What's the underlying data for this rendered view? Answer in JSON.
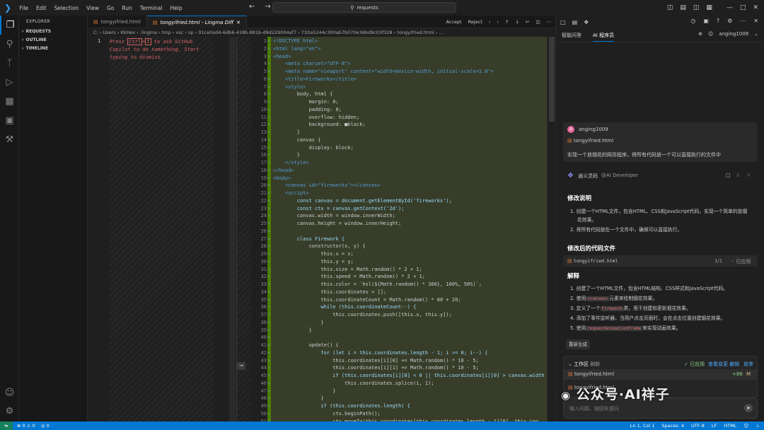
{
  "titlebar": {
    "menus": [
      "File",
      "Edit",
      "Selection",
      "View",
      "Go",
      "Run",
      "Terminal",
      "Help"
    ],
    "search": "requests"
  },
  "activity": [
    "files-icon",
    "search-icon",
    "source-control-icon",
    "run-debug-icon",
    "extensions-icon",
    "remote-icon",
    "testing-icon"
  ],
  "explorer": {
    "header": "EXPLORER",
    "sections": [
      "REQUESTS",
      "OUTLINE",
      "TIMELINE"
    ]
  },
  "tabs": {
    "t1": "tongyifried.html",
    "t2": "tongyifried.html - Lingma Diff",
    "accept": "Accept",
    "reject": "Reject"
  },
  "breadcrumb": "C: › Users › KkHex › .lingma › tmp › vsc › sp › 01ce0ad4-6db6-418b-881b-d9d229004af7 › 730a5244c300ab7b070e36bd9c03f328 › tongyifried.html › ...",
  "left_editor": {
    "line": "1",
    "hint_a": "Press ",
    "key1": "Ctrl",
    "plus": "+",
    "key2": "I",
    "hint_b": " to ask GitHub Copilot to do something. Start typing to dismiss."
  },
  "right_panel": {
    "top": {
      "tab1": "智能问答",
      "tab2": "AI 程序员",
      "user": "anging1009"
    },
    "user_msg": {
      "name": "anging1009",
      "file": "tongyifried.html",
      "text": "实现一个放烟花的网页程序，将所有代码放一个可以直接执行的文件中"
    },
    "assistant": {
      "name": "通义灵码",
      "role": "@AI Developer",
      "h1": "修改说明",
      "p1": "1. 创建一个HTML文件，包含HTML、CSS和JavaScript代码，实现一个简单的放烟",
      "p1b": "花效果。",
      "p2": "2. 将所有代码放在一个文件中，确保可以直接执行。",
      "h2": "修改后的代码文件",
      "file": "tongyifried.html",
      "count": "1/1",
      "applied": "已应用",
      "h3": "解释",
      "e1": "1. 创建了一个HTML文件，包含HTML结构、CSS样式和JavaScript代码。",
      "e2a": "2. 使用",
      "e2code": "<canvas>",
      "e2b": "元素来绘制烟花效果。",
      "e3a": "3. 定义了一个",
      "e3code": "Firework",
      "e3b": "类，用于创建和更新烟花效果。",
      "e4": "4. 添加了事件监听器，当用户点击页面时，会在点击位置创建烟花效果。",
      "e5a": "5. 使用",
      "e5code": "requestAnimationFrame",
      "e5b": "来实现动画效果。",
      "regen": "重新生成"
    },
    "workspace": {
      "title": "工作区",
      "refresh": "刷新",
      "applied": "已应用",
      "view_changes": "查看变更",
      "undo": "撤销",
      "reject": "放弃",
      "file": "tongyifried.html",
      "diff": "+86",
      "badge": "M",
      "file2": "tongyifried.html"
    },
    "input_placeholder": "输入问题，按回车提问"
  },
  "watermark": "公众号·AI祥子",
  "status": {
    "errors": "⊗ 0 ⚠ 0",
    "ports": "◎ 0",
    "ln": "Ln 1, Col 1",
    "spaces": "Spaces: 4",
    "enc": "UTF-8",
    "eol": "LF",
    "lang": "HTML"
  },
  "code_lines": [
    "<!DOCTYPE html>",
    "<html lang=\"en\">",
    "<head>",
    "    <meta charset=\"UTF-8\">",
    "    <meta name=\"viewport\" content=\"width=device-width, initial-scale=1.0\">",
    "    <title>Fireworks</title>",
    "    <style>",
    "        body, html {",
    "            margin: 0;",
    "            padding: 0;",
    "            overflow: hidden;",
    "            background: ■black;",
    "        }",
    "        canvas {",
    "            display: block;",
    "        }",
    "    </style>",
    "</head>",
    "<body>",
    "    <canvas id=\"fireworks\"></canvas>",
    "    <script>",
    "        const canvas = document.getElementById('fireworks');",
    "        const ctx = canvas.getContext('2d');",
    "        canvas.width = window.innerWidth;",
    "        canvas.height = window.innerHeight;",
    "",
    "        class Firework {",
    "            constructor(x, y) {",
    "                this.x = x;",
    "                this.y = y;",
    "                this.size = Math.random() * 2 + 1;",
    "                this.speed = Math.random() * 2 + 1;",
    "                this.color = `hsl(${Math.random() * 360}, 100%, 50%)`;",
    "                this.coordinates = [];",
    "                this.coordinateCount = Math.random() * 80 + 20;",
    "                while (this.coordinateCount--) {",
    "                    this.coordinates.push([this.x, this.y]);",
    "                }",
    "            }",
    "",
    "            update() {",
    "                for (let i = this.coordinates.length - 1; i >= 0; i--) {",
    "                    this.coordinates[i][0] += Math.random() * 10 - 5;",
    "                    this.coordinates[i][1] += Math.random() * 10 - 5;",
    "                    if (this.coordinates[i][0] < 0 || this.coordinates[i][0] > canvas.width",
    "                        this.coordinates.splice(i, 1);",
    "                    }",
    "                }",
    "                if (this.coordinates.length) {",
    "                    ctx.beginPath();",
    "                    ctx.moveTo(this.coordinates[this.coordinates.length - 1][0], this.coo"
  ]
}
